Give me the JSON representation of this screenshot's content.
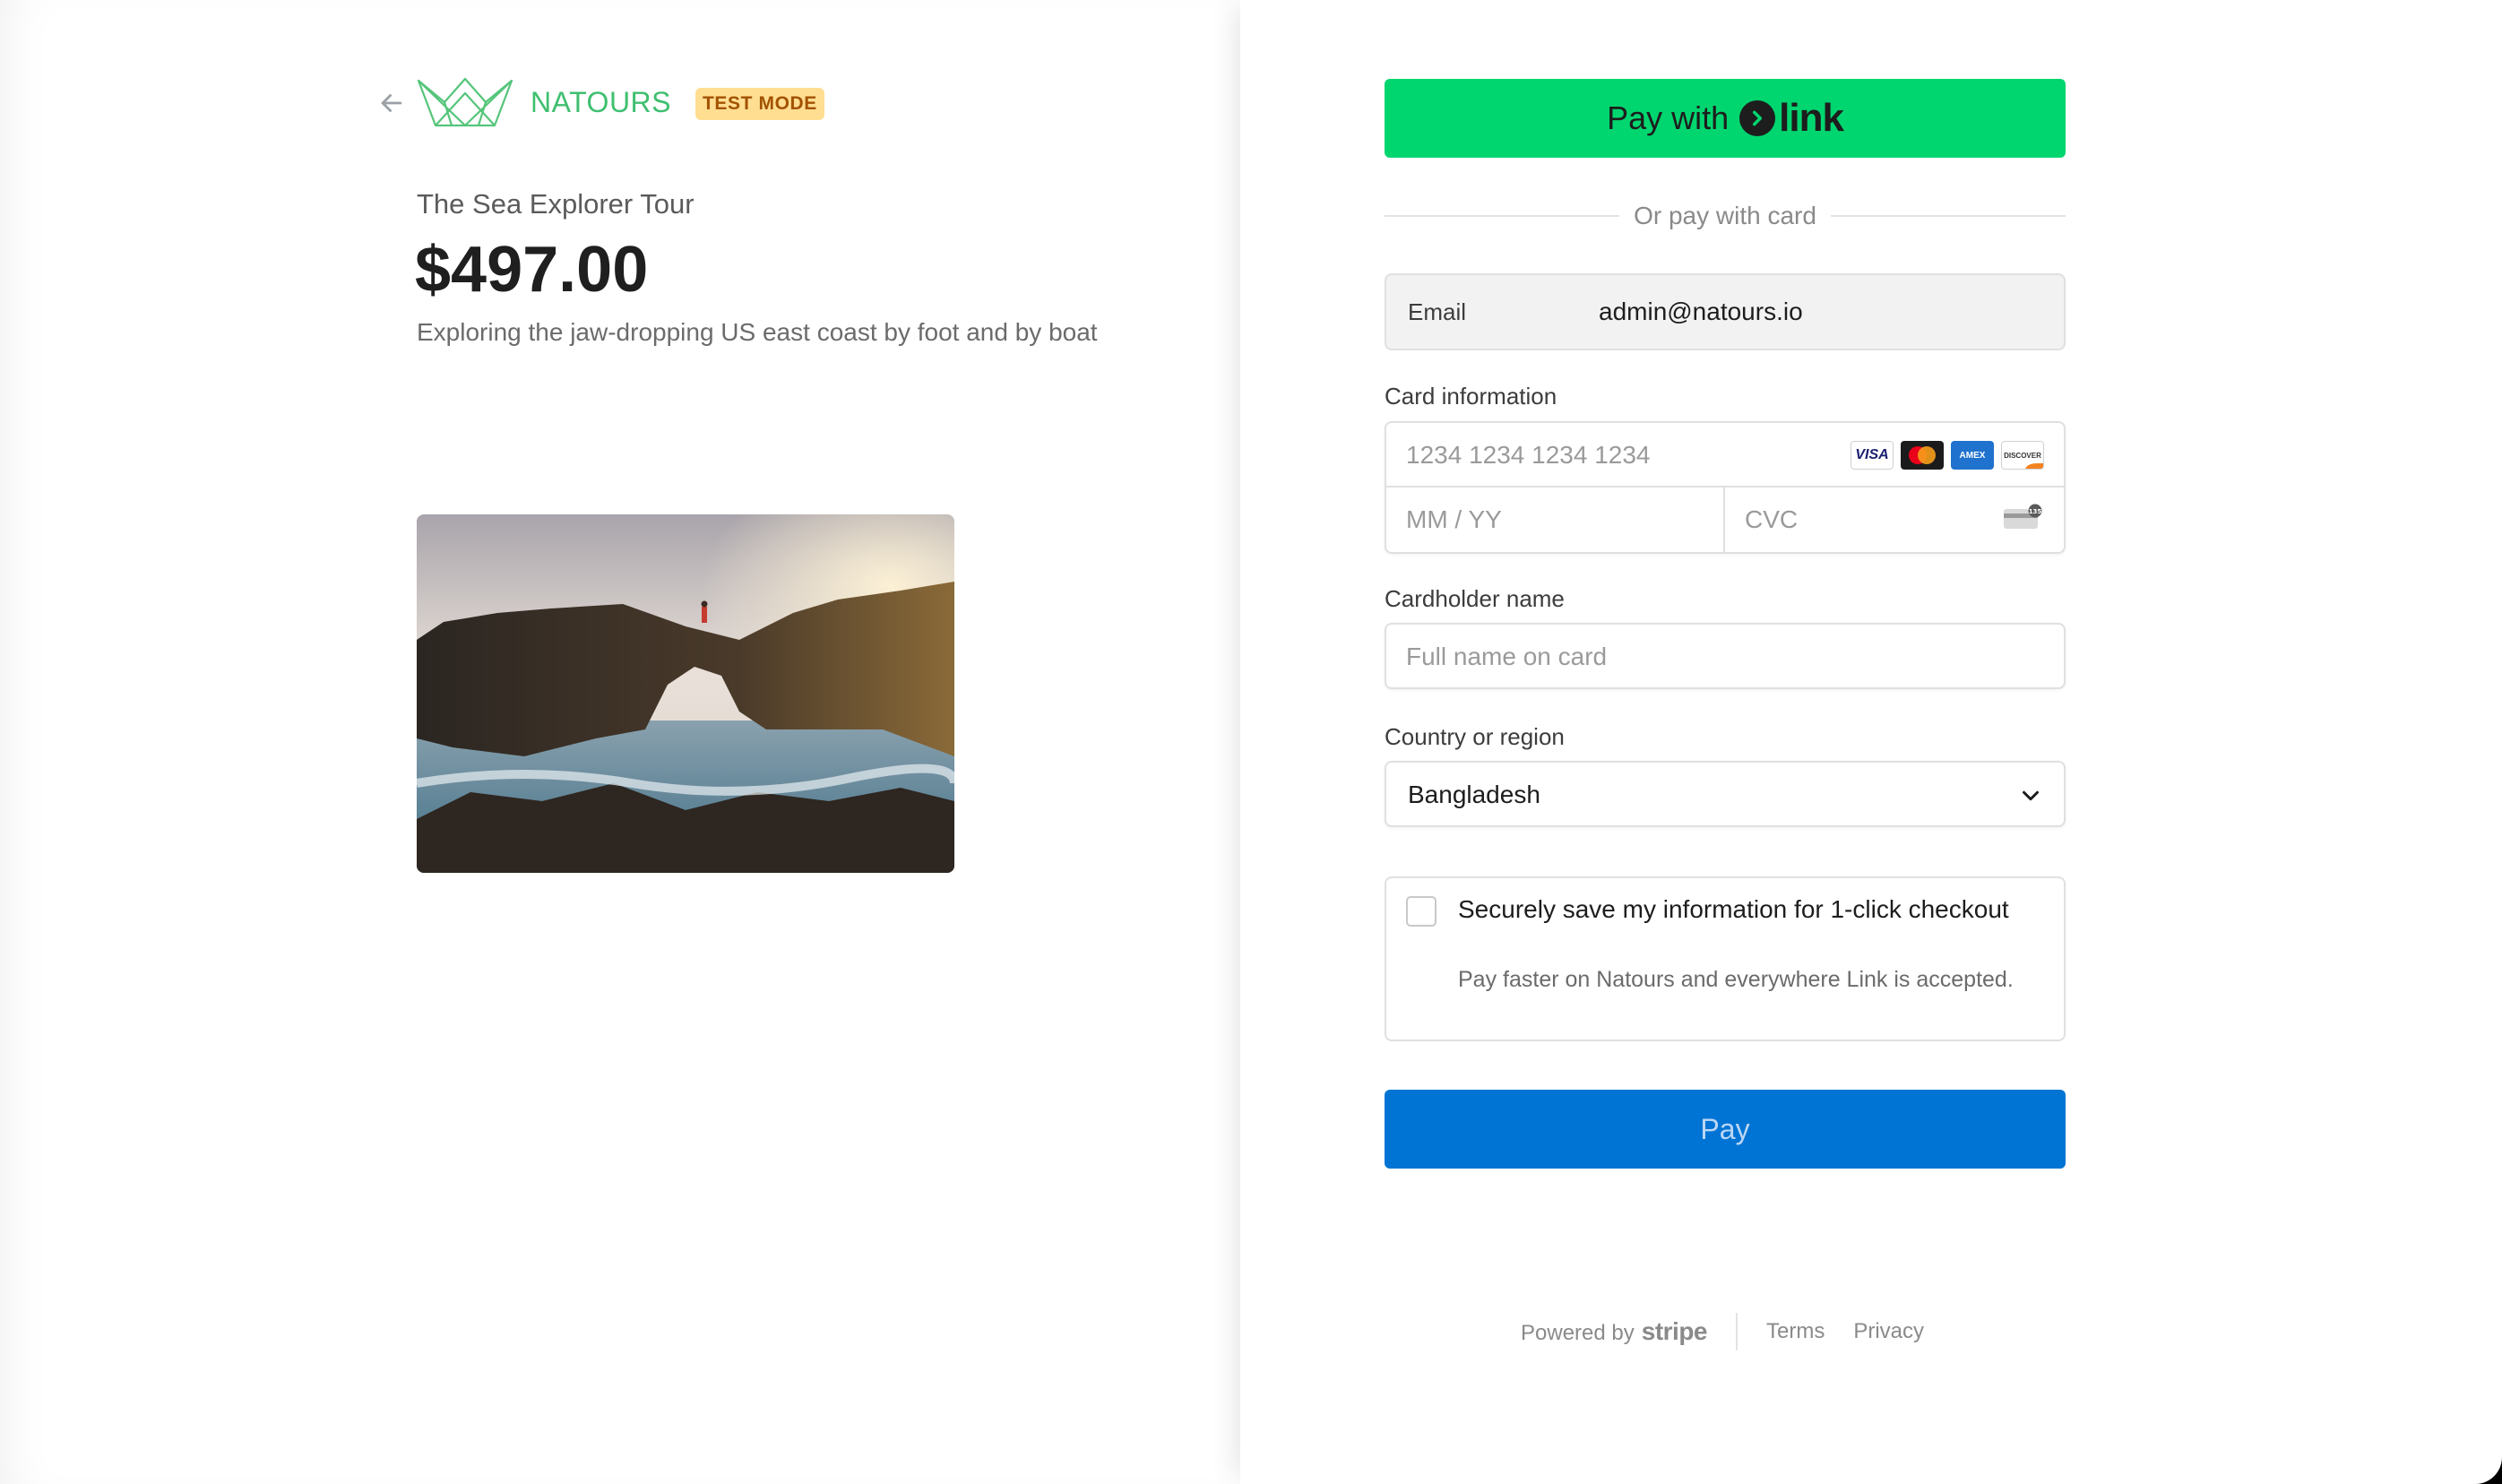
{
  "brand": {
    "name": "NATOURS",
    "badge": "TEST MODE",
    "logo_color": "#55c57a"
  },
  "product": {
    "name": "The Sea Explorer Tour",
    "price": "$497.00",
    "description": "Exploring the jaw-dropping US east coast by foot and by boat"
  },
  "payment": {
    "link_button": {
      "prefix": "Pay with",
      "logo_text": "link"
    },
    "divider_text": "Or pay with card",
    "email": {
      "label": "Email",
      "value": "admin@natours.io"
    },
    "card_info": {
      "label": "Card information",
      "number_placeholder": "1234 1234 1234 1234",
      "expiry_placeholder": "MM / YY",
      "cvc_placeholder": "CVC",
      "brands": [
        "VISA",
        "mastercard",
        "AMEX",
        "DISCOVER"
      ]
    },
    "cardholder": {
      "label": "Cardholder name",
      "placeholder": "Full name on card"
    },
    "country": {
      "label": "Country or region",
      "value": "Bangladesh"
    },
    "save_info": {
      "title": "Securely save my information for 1-click checkout",
      "subtitle": "Pay faster on Natours and everywhere Link is accepted."
    },
    "pay_label": "Pay"
  },
  "footer": {
    "powered_by": "Powered by",
    "stripe": "stripe",
    "terms": "Terms",
    "privacy": "Privacy"
  },
  "colors": {
    "link_green": "#00d66f",
    "pay_blue": "#0074d4",
    "brand_green": "#3fbf6f",
    "badge_bg": "#ffde92",
    "badge_text": "#a35200"
  }
}
